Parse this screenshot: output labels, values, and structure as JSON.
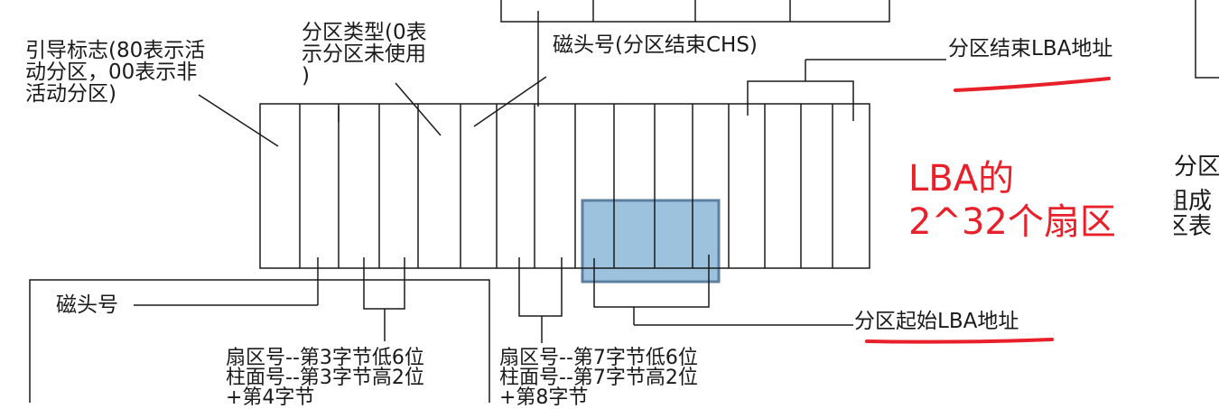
{
  "labels": {
    "boot_flag": [
      "引导标志(80表示活",
      "动分区，00表示非",
      "活动分区)"
    ],
    "partition_type": [
      "分区类型(0表",
      "示分区未使用",
      ")"
    ],
    "head_end": "磁头号(分区结束CHS)",
    "end_lba": "分区结束LBA地址",
    "head_start": "磁头号",
    "start_lba": "分区起始LBA地址",
    "start_sector_desc": [
      "扇区号--第3字节低6位",
      "柱面号--第3字节高2位",
      "+第4字节"
    ],
    "end_sector_desc": [
      "扇区号--第7字节低6位",
      "柱面号--第7字节高2位",
      "+第8字节"
    ],
    "lba_note": [
      "LBA的",
      "2^32个扇区"
    ],
    "right_clipped": [
      "分区",
      "组成",
      "区表"
    ]
  },
  "colors": {
    "line": "#1a1a1a",
    "highlight_fill": "#9cc2de",
    "highlight_stroke": "#5d7fa0",
    "annotation": "#e8202a"
  }
}
